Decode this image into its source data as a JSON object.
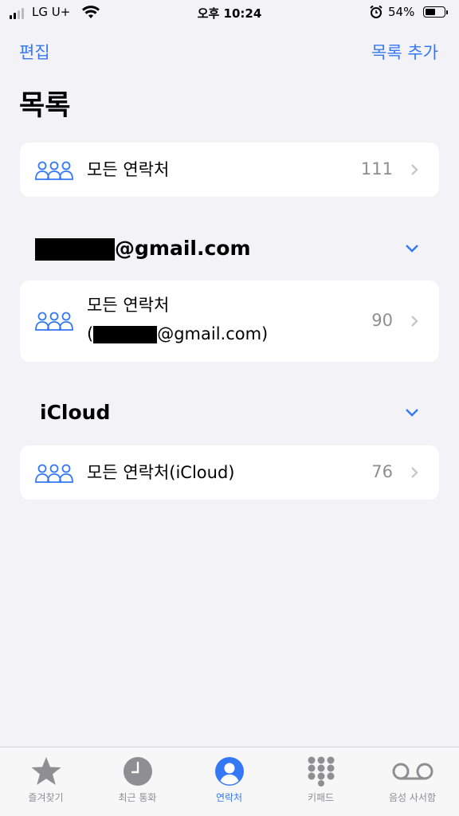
{
  "status": {
    "carrier": "LG U+",
    "time": "오후 10:24",
    "battery": "54%",
    "battery_level": 0.54
  },
  "nav": {
    "left": "편집",
    "right": "목록 추가"
  },
  "title": "목록",
  "accent": "#3478f6",
  "all_contacts": {
    "label": "모든 연락처",
    "count": "111"
  },
  "gmail": {
    "header": "@gmail.com",
    "label_line1": "모든 연락처",
    "label_open": "(",
    "label_suffix": "@gmail.com)",
    "count": "90"
  },
  "icloud": {
    "header": "iCloud",
    "label": "모든 연락처(iCloud)",
    "count": "76"
  },
  "tabs": [
    {
      "label": "즐겨찾기",
      "icon": "star-icon"
    },
    {
      "label": "최근 통화",
      "icon": "clock-icon"
    },
    {
      "label": "연락처",
      "icon": "person-circle-icon",
      "active": true
    },
    {
      "label": "키패드",
      "icon": "keypad-icon"
    },
    {
      "label": "음성 사서함",
      "icon": "voicemail-icon"
    }
  ]
}
